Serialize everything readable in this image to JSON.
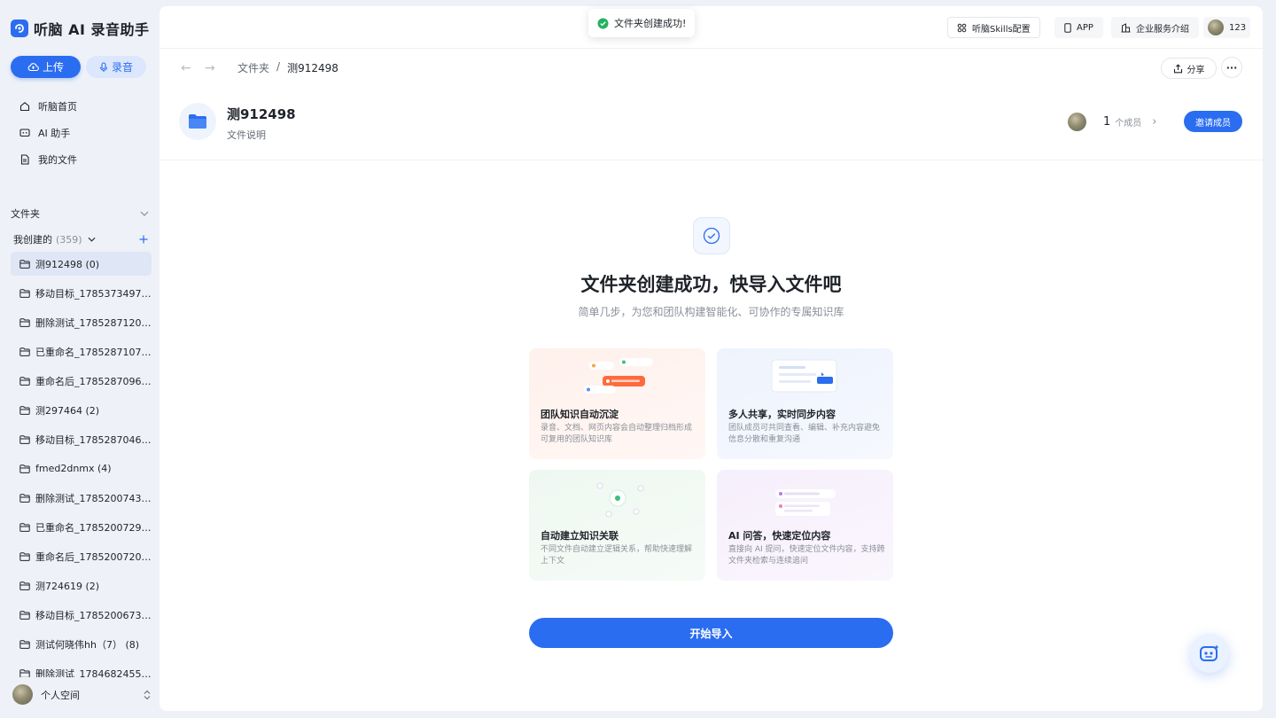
{
  "brand": {
    "name": "听脑 AI 录音助手"
  },
  "sidebar": {
    "upload_label": "上传",
    "record_label": "录音",
    "nav": [
      {
        "label": "听脑首页",
        "icon": "home-icon"
      },
      {
        "label": "AI 助手",
        "icon": "ai-assistant-icon"
      },
      {
        "label": "我的文件",
        "icon": "file-icon"
      }
    ],
    "folders_section": "文件夹",
    "mine_label": "我创建的",
    "mine_count": "(359)",
    "folders": [
      "测912498 (0)",
      "移动目标_1785373497 ...",
      "删除测试_1785287120 ...",
      "已重命名_1785287107 (...",
      "重命名后_1785287096 ...",
      "测297464 (2)",
      "移动目标_1785287046 ...",
      "fmed2dnmx (4)",
      "删除测试_1785200743 ...",
      "已重命名_1785200729 ...",
      "重命名后_1785200720 ...",
      "测724619 (2)",
      "移动目标_1785200673 ...",
      "测试何晓伟hh（7） (8)",
      "删除测试_1784682455 ..."
    ],
    "space_label": "个人空间"
  },
  "topbar": {
    "skills_label": "听脑Skills配置",
    "app_label": "APP",
    "enterprise_label": "企业服务介绍",
    "user_label": "123"
  },
  "toast": {
    "text": "文件夹创建成功!"
  },
  "breadcrumb": {
    "root": "文件夹",
    "separator": "/",
    "current": "测912498"
  },
  "actions": {
    "share_label": "分享",
    "more_label": "···"
  },
  "folder": {
    "title": "测912498",
    "description": "文件说明",
    "member_count": "1",
    "member_label": "个成员",
    "invite_label": "邀请成员"
  },
  "empty_state": {
    "title": "文件夹创建成功，快导入文件吧",
    "subtitle": "简单几步，为您和团队构建智能化、可协作的专属知识库",
    "cards": [
      {
        "title": "团队知识自动沉淀",
        "desc": "录音、文档、网页内容会自动整理归档形成可复用的团队知识库"
      },
      {
        "title": "多人共享，实时同步内容",
        "desc": "团队成员可共同查看、编辑、补充内容避免信息分散和重复沟通"
      },
      {
        "title": "自动建立知识关联",
        "desc": "不同文件自动建立逻辑关系，帮助快速理解上下文"
      },
      {
        "title": "AI 问答，快速定位内容",
        "desc": "直接向 AI 提问，快速定位文件内容，支持跨文件夹检索与连续追问"
      }
    ],
    "start_label": "开始导入"
  },
  "colors": {
    "accent": "#2b6df0",
    "success": "#22b35e"
  }
}
